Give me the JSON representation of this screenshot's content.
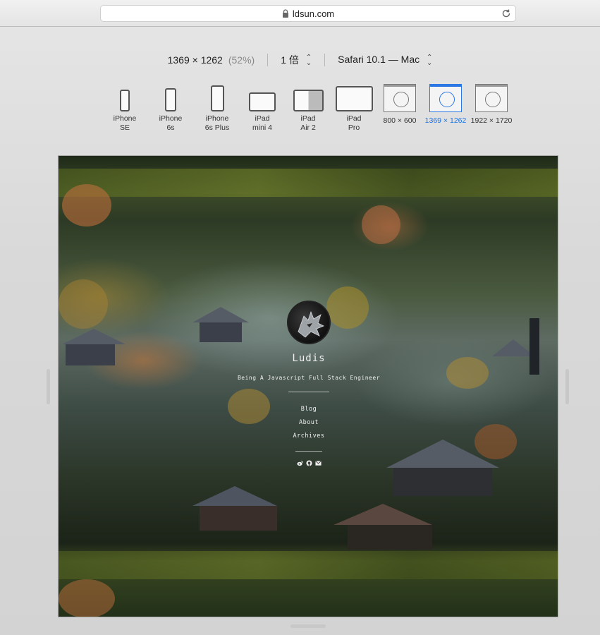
{
  "browser": {
    "url": "ldsun.com"
  },
  "responsive": {
    "resolution": "1369 × 1262",
    "scale": "(52%)",
    "pixel_ratio": "1 倍",
    "user_agent": "Safari 10.1 — Mac"
  },
  "devices": [
    {
      "line1": "iPhone",
      "line2": "SE"
    },
    {
      "line1": "iPhone",
      "line2": "6s"
    },
    {
      "line1": "iPhone",
      "line2": "6s Plus"
    },
    {
      "line1": "iPad",
      "line2": "mini 4"
    },
    {
      "line1": "iPad",
      "line2": "Air 2"
    },
    {
      "line1": "iPad",
      "line2": "Pro"
    },
    {
      "line1": "800 × 600",
      "line2": ""
    },
    {
      "line1": "1369 × 1262",
      "line2": ""
    },
    {
      "line1": "1922 × 1720",
      "line2": ""
    }
  ],
  "selected_device_index": 7,
  "site": {
    "name": "Ludis",
    "tagline": "Being A Javascript Full Stack Engineer",
    "menu": [
      "Blog",
      "About",
      "Archives"
    ],
    "social_icons": [
      "weibo-icon",
      "github-icon",
      "email-icon"
    ]
  },
  "colors": {
    "accent": "#1a73e8"
  }
}
